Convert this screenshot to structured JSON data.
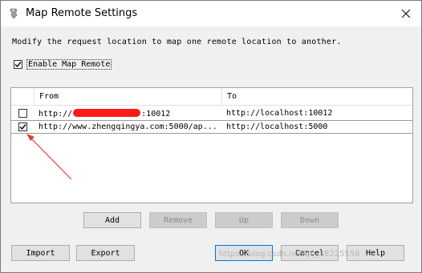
{
  "window": {
    "title": "Map Remote Settings",
    "icons": {
      "app": "app-icon",
      "close": "close-icon"
    }
  },
  "description": "Modify the request location to map one remote location to another.",
  "enable_checkbox": {
    "label": "Enable Map Remote",
    "checked": true
  },
  "table": {
    "columns": [
      "From",
      "To"
    ],
    "rows": [
      {
        "checked": false,
        "from_prefix": "http://",
        "from_suffix": ":10012",
        "to": "http://localhost:10012"
      },
      {
        "checked": true,
        "from": "http://www.zhengqingya.com:5000/ap...",
        "to": "http://localhost:5000"
      }
    ]
  },
  "list_buttons": {
    "add": "Add",
    "remove": "Remove",
    "up": "Up",
    "down": "Down"
  },
  "footer_buttons": {
    "import": "Import",
    "export": "Export",
    "ok": "OK",
    "cancel": "Cancel",
    "help": "Help"
  },
  "watermark": "https://blog.csdn.net/qq_38225558",
  "colors": {
    "annotation_arrow": "#e53935",
    "redaction": "#ff1a1a",
    "default_button_border": "#0078d7"
  }
}
